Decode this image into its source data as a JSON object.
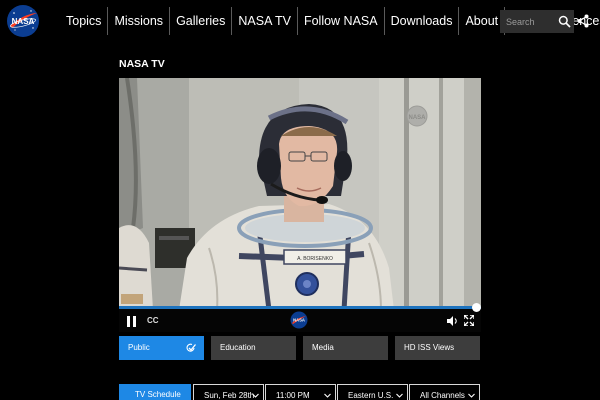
{
  "nav": {
    "logo_text": "NASA",
    "items": [
      "Topics",
      "Missions",
      "Galleries",
      "NASA TV",
      "Follow NASA",
      "Downloads",
      "About",
      "NASA Audiences"
    ],
    "search_placeholder": "Search"
  },
  "page": {
    "title": "NASA TV"
  },
  "player": {
    "progress": 1.0,
    "cc_label": "CC",
    "logo_text": "NASA"
  },
  "tabs": [
    {
      "label": "Public",
      "active": true
    },
    {
      "label": "Education",
      "active": false
    },
    {
      "label": "Media",
      "active": false
    },
    {
      "label": "HD ISS Views",
      "active": false
    }
  ],
  "schedule": {
    "button_label": "TV Schedule",
    "date": "Sun, Feb 28th",
    "time": "11:00 PM",
    "timezone": "Eastern U.S.",
    "channels": "All Channels"
  },
  "colors": {
    "accent": "#1e88e5",
    "tab_inactive": "#3d3d3d",
    "nasa_blue": "#0b3d91",
    "nasa_red": "#fc3d21"
  }
}
